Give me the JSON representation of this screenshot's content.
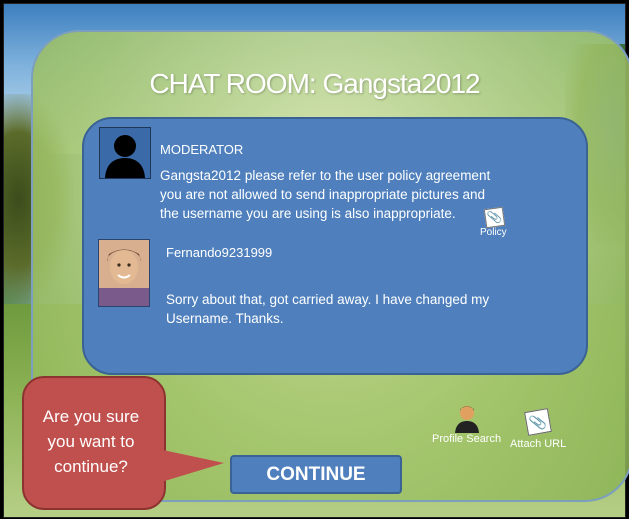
{
  "title": "CHAT ROOM: Gangsta2012",
  "messages": [
    {
      "sender": "MODERATOR",
      "lines": [
        "Gangsta2012 please refer to the user policy agreement",
        "you are not allowed to send inappropriate pictures and",
        "the username you are using is also inappropriate."
      ]
    },
    {
      "sender": "Fernando9231999",
      "lines": [
        "Sorry about that, got carried away. I have changed my",
        "Username. Thanks."
      ]
    }
  ],
  "policy": {
    "label": "Policy",
    "icon": "paperclip-icon"
  },
  "callout": {
    "lines": [
      "Are you sure",
      "you want to",
      "continue?"
    ]
  },
  "continue_button": "CONTINUE",
  "tools": {
    "profile_search": {
      "label": "Profile Search",
      "icon": "person-icon"
    },
    "attach_url": {
      "label": "Attach URL",
      "icon": "paperclip-icon"
    }
  },
  "colors": {
    "chat_box": "#4f80bd",
    "callout": "#c0504d",
    "panel": "#a6c76e"
  }
}
